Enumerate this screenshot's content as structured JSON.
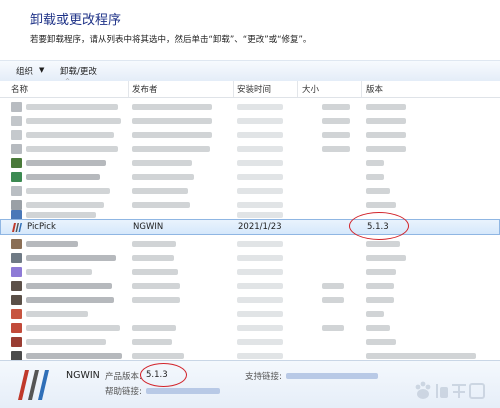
{
  "header": {
    "title": "卸载或更改程序",
    "subtitle": "若要卸载程序，请从列表中将其选中，然后单击“卸载”、“更改”或“修复”。"
  },
  "toolbar": {
    "organize": "组织",
    "arrow": "▼",
    "uninstall_change": "卸载/更改"
  },
  "columns": {
    "name": "名称",
    "publisher": "发布者",
    "installed_on": "安装时间",
    "size": "大小",
    "version": "版本",
    "sort_caret": "^"
  },
  "selected_row": {
    "name": "PicPick",
    "publisher": "NGWIN",
    "installed_on": "2021/1/23",
    "version": "5.1.3"
  },
  "details": {
    "publisher": "NGWIN",
    "product_version_label": "产品版本:",
    "product_version": "5.1.3",
    "support_link_label": "支持链接:",
    "help_link_label": "帮助链接:"
  },
  "colors": {
    "title": "#1e3287",
    "highlight_ring": "#d2232a",
    "selected_border": "#8fb6e3"
  },
  "icons": {
    "app_icon": "picpick-icon",
    "logo": "ngwin-logo"
  }
}
